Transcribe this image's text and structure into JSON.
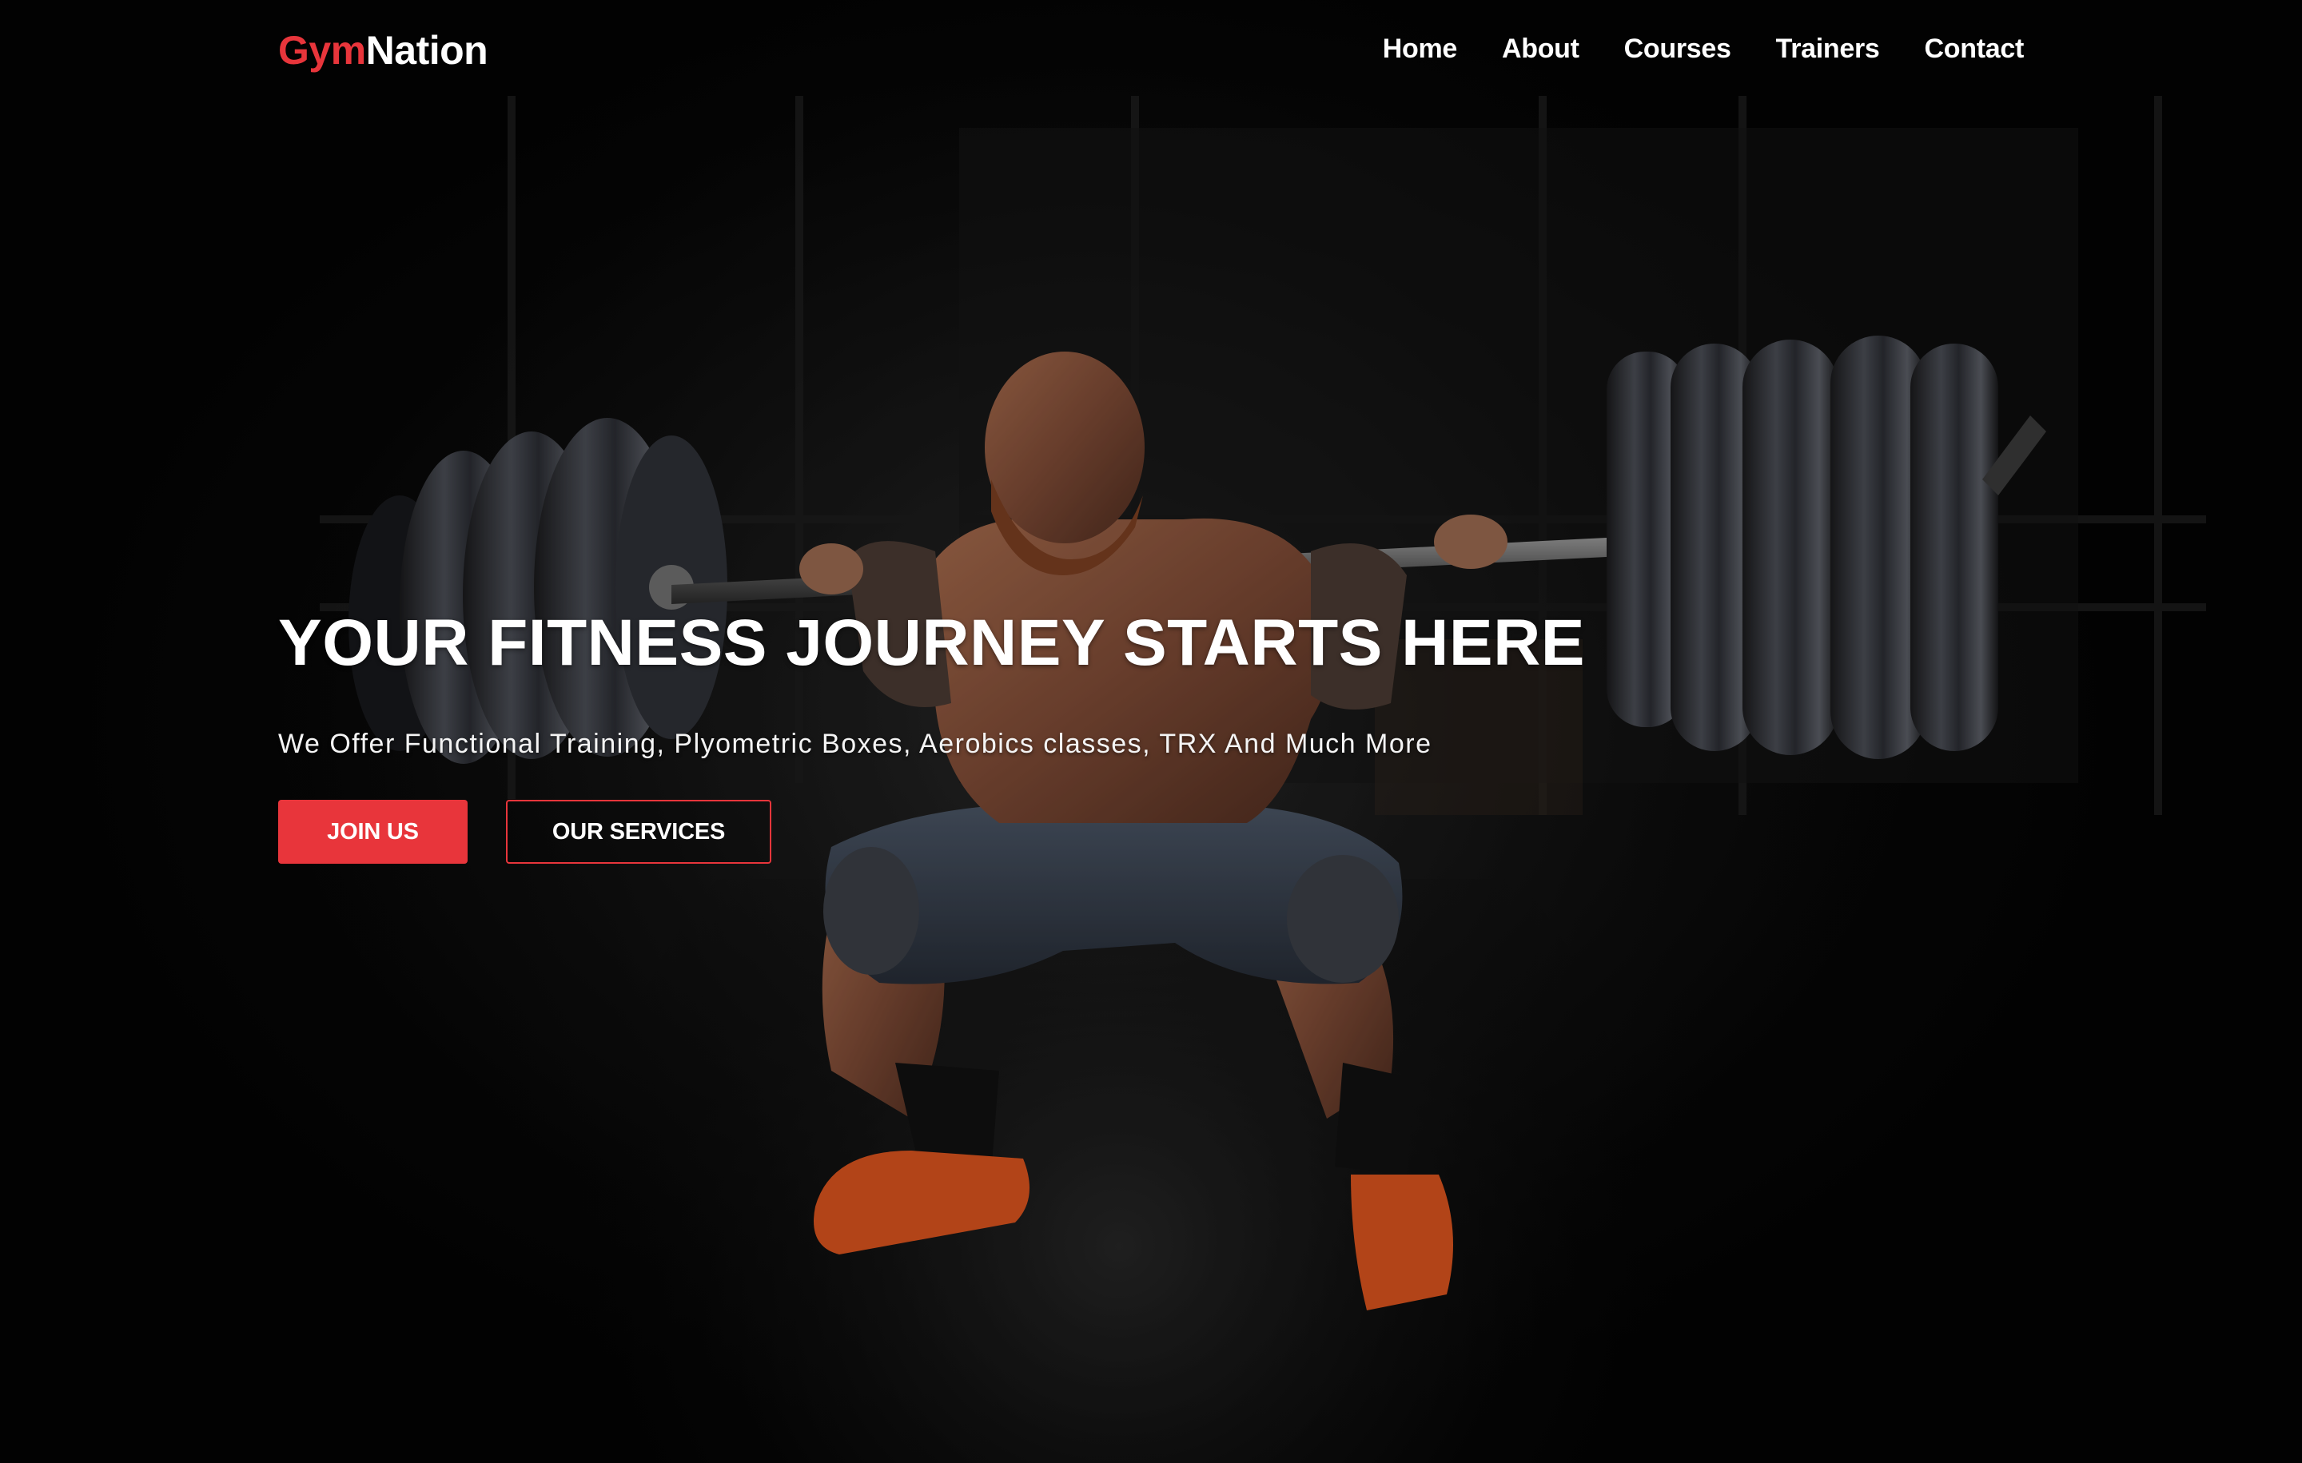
{
  "brand": {
    "part1": "Gym",
    "part2": "Nation",
    "accent_color": "#e8353b"
  },
  "nav": {
    "items": [
      {
        "label": "Home"
      },
      {
        "label": "About"
      },
      {
        "label": "Courses"
      },
      {
        "label": "Trainers"
      },
      {
        "label": "Contact"
      }
    ]
  },
  "hero": {
    "headline": "YOUR FITNESS JOURNEY STARTS HERE",
    "subline": "We Offer Functional Training, Plyometric Boxes, Aerobics classes, TRX And Much More",
    "primary_button": "JOIN US",
    "secondary_button": "OUR SERVICES",
    "background_image": "weightlifter-squatting-barbell-photo"
  }
}
